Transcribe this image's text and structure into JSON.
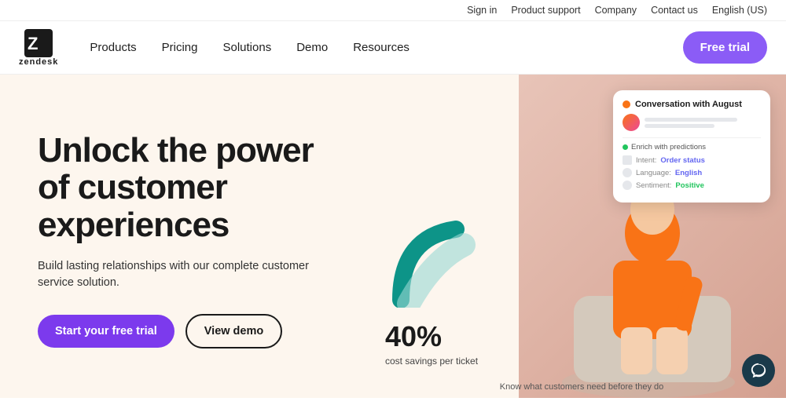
{
  "topbar": {
    "links": [
      "Sign in",
      "Product support",
      "Company",
      "Contact us",
      "English (US)"
    ]
  },
  "nav": {
    "logo_text": "zendesk",
    "links": [
      "Products",
      "Pricing",
      "Solutions",
      "Demo",
      "Resources"
    ],
    "cta_label": "Free trial"
  },
  "hero": {
    "headline": "Unlock the power of customer experiences",
    "subtext": "Build lasting relationships with our complete customer service solution.",
    "btn_primary": "Start your free trial",
    "btn_secondary": "View demo",
    "stat_number": "40",
    "stat_suffix": "%",
    "stat_label": "cost savings per ticket",
    "caption": "Know what customers need before they do"
  },
  "conv_card": {
    "title": "Conversation with August",
    "section_title": "Enrich with predictions",
    "rows": [
      {
        "label": "Intent:",
        "value": "Order status"
      },
      {
        "label": "Language:",
        "value": "English"
      },
      {
        "label": "Sentiment:",
        "value": "Positive"
      }
    ]
  },
  "icons": {
    "chat": "💬"
  }
}
